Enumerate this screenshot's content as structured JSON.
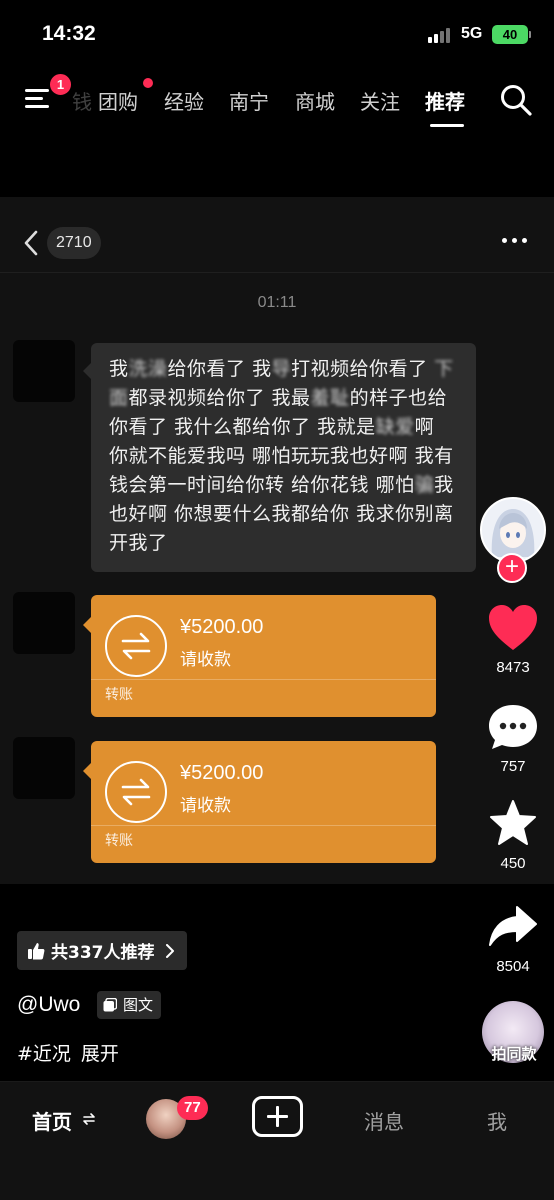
{
  "status_bar": {
    "time": "14:32",
    "network": "5G",
    "battery": "40"
  },
  "top_nav": {
    "menu_badge": "1",
    "tabs": [
      {
        "label": "团购"
      },
      {
        "label": "经验"
      },
      {
        "label": "南宁"
      },
      {
        "label": "商城"
      },
      {
        "label": "关注"
      },
      {
        "label": "推荐"
      }
    ],
    "active_tab": "推荐"
  },
  "chat": {
    "message_count": "2710",
    "timestamp": "01:11",
    "message_segments": [
      {
        "text": "我",
        "blurred": false
      },
      {
        "text": "洗澡",
        "blurred": true
      },
      {
        "text": "给你看了 我",
        "blurred": false
      },
      {
        "text": "导",
        "blurred": true
      },
      {
        "text": "打视频给你看了 ",
        "blurred": false
      },
      {
        "text": "下面",
        "blurred": true
      },
      {
        "text": "都录视频给你了 我最",
        "blurred": false
      },
      {
        "text": "羞耻",
        "blurred": true
      },
      {
        "text": "的样子也给你看了 我什么都给你了 我就是",
        "blurred": false
      },
      {
        "text": "缺爱",
        "blurred": true
      },
      {
        "text": "啊 你就不能爱我吗 哪怕玩玩我也好啊 我有钱会第一时间给你转 给你花钱 哪怕",
        "blurred": false
      },
      {
        "text": "骗",
        "blurred": true
      },
      {
        "text": "我也好啊 你想要什么我都给你 我求你别离开我了",
        "blurred": false
      }
    ],
    "transfers": [
      {
        "amount": "¥5200.00",
        "subtitle": "请收款",
        "label": "转账"
      },
      {
        "amount": "¥5200.00",
        "subtitle": "请收款",
        "label": "转账"
      }
    ]
  },
  "sidebar": {
    "likes": "8473",
    "comments": "757",
    "favorites": "450",
    "shares": "8504",
    "same_style_label": "拍同款",
    "like_color": "#fe2c55"
  },
  "post": {
    "recommend_text": "共337人推荐",
    "author": "@Uwo",
    "type_label": "图文",
    "hashtag": "#近况",
    "expand_label": "展开"
  },
  "bottom_nav": {
    "home": "首页",
    "friend_badge": "77",
    "messages": "消息",
    "me": "我"
  }
}
